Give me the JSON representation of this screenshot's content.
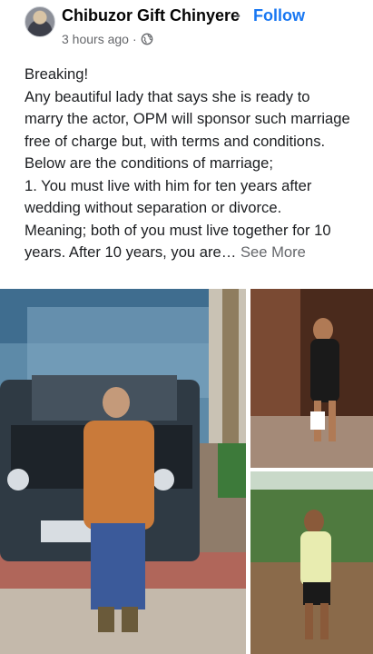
{
  "post": {
    "author": "Chibuzor Gift Chinyere",
    "follow_label": "Follow",
    "time": "3 hours ago",
    "separator": "•",
    "body": "Breaking!\nAny beautiful lady that says she is ready to marry the actor, OPM will sponsor such marriage free of charge but, with terms and conditions.\nBelow are the conditions of marriage;\n1. You must live with him for ten years after wedding without separation or divorce.\nMeaning; both of you must live together for 10 years. After 10 years, you are… ",
    "see_more": "See More"
  },
  "icons": {
    "audience": "globe-icon",
    "avatar": "profile-avatar"
  },
  "colors": {
    "link": "#1877f2",
    "meta": "#65676b"
  }
}
